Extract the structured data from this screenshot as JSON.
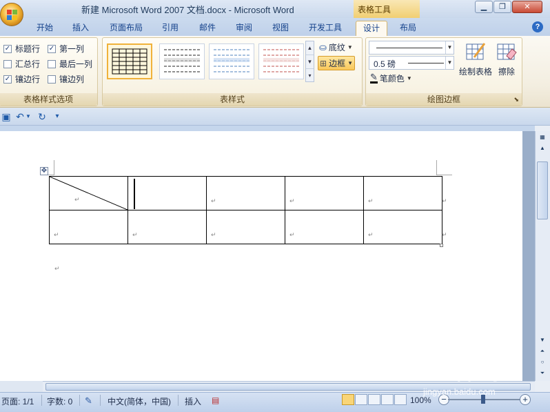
{
  "window": {
    "title": "新建 Microsoft Word 2007 文档.docx - Microsoft Word",
    "context_header": "表格工具",
    "minimize": "▁",
    "maximize": "❐",
    "close": "✕"
  },
  "tabs": [
    "开始",
    "插入",
    "页面布局",
    "引用",
    "邮件",
    "审阅",
    "视图",
    "开发工具",
    "设计",
    "布局"
  ],
  "active_tab": "设计",
  "help": "?",
  "ribbon": {
    "options_group": {
      "label": "表格样式选项",
      "items": [
        {
          "label": "标题行",
          "checked": true
        },
        {
          "label": "第一列",
          "checked": true
        },
        {
          "label": "汇总行",
          "checked": false
        },
        {
          "label": "最后一列",
          "checked": false
        },
        {
          "label": "镶边行",
          "checked": true
        },
        {
          "label": "镶边列",
          "checked": false
        }
      ]
    },
    "styles_group": {
      "label": "表样式",
      "shading": "底纹",
      "borders": "边框"
    },
    "draw_group": {
      "label": "绘图边框",
      "line_weight": "0.5 磅",
      "pen_color": "笔颜色",
      "draw_table": "绘制表格",
      "eraser": "擦除"
    }
  },
  "document": {
    "paragraph_mark": "↵",
    "table": {
      "rows": 2,
      "cols": 5
    }
  },
  "status": {
    "page": "页面: 1/1",
    "words": "字数: 0",
    "language": "中文(简体，中国)",
    "mode": "插入",
    "zoom": "100%",
    "zoom_level": 1.0
  },
  "watermark": {
    "main": "Bai百经验",
    "sub": "jingyan.baidu.com"
  }
}
